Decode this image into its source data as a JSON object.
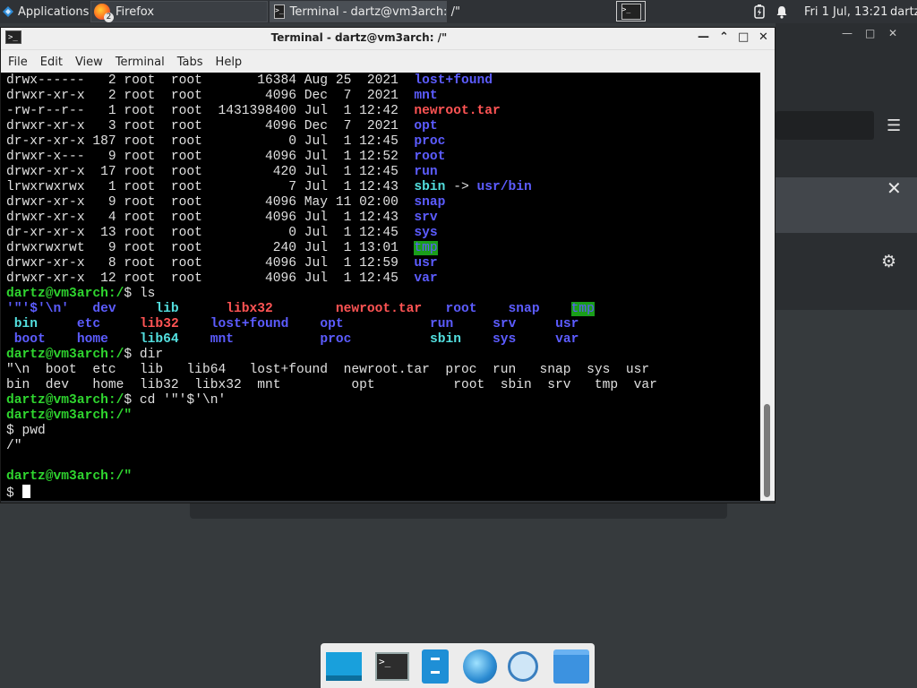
{
  "top_panel": {
    "applications_label": "Applications",
    "tasks": [
      {
        "label": "Firefox",
        "badge": "2"
      },
      {
        "label": "Terminal - dartz@vm3arch: /\""
      }
    ],
    "clock": "Fri  1 Jul, 13:21",
    "user": "dartz"
  },
  "terminal_window": {
    "title": "Terminal - dartz@vm3arch: /\"",
    "menu": [
      "File",
      "Edit",
      "View",
      "Terminal",
      "Tabs",
      "Help"
    ],
    "lines": [
      [
        {
          "t": "drwx------   2 root  root       16384 Aug 25  2021  "
        },
        {
          "t": "lost+found",
          "c": "c-dir"
        }
      ],
      [
        {
          "t": "drwxr-xr-x   2 root  root        4096 Dec  7  2021  "
        },
        {
          "t": "mnt",
          "c": "c-dir"
        }
      ],
      [
        {
          "t": "-rw-r--r--   1 root  root  1431398400 Jul  1 12:42  "
        },
        {
          "t": "newroot.tar",
          "c": "c-red"
        }
      ],
      [
        {
          "t": "drwxr-xr-x   3 root  root        4096 Dec  7  2021  "
        },
        {
          "t": "opt",
          "c": "c-dir"
        }
      ],
      [
        {
          "t": "dr-xr-xr-x 187 root  root           0 Jul  1 12:45  "
        },
        {
          "t": "proc",
          "c": "c-dir"
        }
      ],
      [
        {
          "t": "drwxr-x---   9 root  root        4096 Jul  1 12:52  "
        },
        {
          "t": "root",
          "c": "c-dir"
        }
      ],
      [
        {
          "t": "drwxr-xr-x  17 root  root         420 Jul  1 12:45  "
        },
        {
          "t": "run",
          "c": "c-dir"
        }
      ],
      [
        {
          "t": "lrwxrwxrwx   1 root  root           7 Jul  1 12:43  "
        },
        {
          "t": "sbin",
          "c": "c-cyan"
        },
        {
          "t": " -> "
        },
        {
          "t": "usr/bin",
          "c": "c-dir"
        }
      ],
      [
        {
          "t": "drwxr-xr-x   9 root  root        4096 May 11 02:00  "
        },
        {
          "t": "snap",
          "c": "c-dir"
        }
      ],
      [
        {
          "t": "drwxr-xr-x   4 root  root        4096 Jul  1 12:43  "
        },
        {
          "t": "srv",
          "c": "c-dir"
        }
      ],
      [
        {
          "t": "dr-xr-xr-x  13 root  root           0 Jul  1 12:45  "
        },
        {
          "t": "sys",
          "c": "c-dir"
        }
      ],
      [
        {
          "t": "drwxrwxrwt   9 root  root         240 Jul  1 13:01  "
        },
        {
          "t": "tmp",
          "c": "c-tmp"
        }
      ],
      [
        {
          "t": "drwxr-xr-x   8 root  root        4096 Jul  1 12:59  "
        },
        {
          "t": "usr",
          "c": "c-dir"
        }
      ],
      [
        {
          "t": "drwxr-xr-x  12 root  root        4096 Jul  1 12:45  "
        },
        {
          "t": "var",
          "c": "c-dir"
        }
      ],
      [
        {
          "t": "dartz@vm3arch:/",
          "c": "c-prompt"
        },
        {
          "t": "$ ls"
        }
      ],
      [
        {
          "t": "'\"'$'\\n'",
          "c": "c-dir"
        },
        {
          "t": "   "
        },
        {
          "t": "dev",
          "c": "c-dir"
        },
        {
          "t": "     "
        },
        {
          "t": "lib",
          "c": "c-cyan"
        },
        {
          "t": "      "
        },
        {
          "t": "libx32",
          "c": "c-red"
        },
        {
          "t": "        "
        },
        {
          "t": "newroot.tar",
          "c": "c-red"
        },
        {
          "t": "   "
        },
        {
          "t": "root",
          "c": "c-dir"
        },
        {
          "t": "    "
        },
        {
          "t": "snap",
          "c": "c-dir"
        },
        {
          "t": "    "
        },
        {
          "t": "tmp",
          "c": "c-tmp"
        }
      ],
      [
        {
          "t": " "
        },
        {
          "t": "bin",
          "c": "c-cyan"
        },
        {
          "t": "     "
        },
        {
          "t": "etc",
          "c": "c-dir"
        },
        {
          "t": "     "
        },
        {
          "t": "lib32",
          "c": "c-red"
        },
        {
          "t": "    "
        },
        {
          "t": "lost+found",
          "c": "c-dir"
        },
        {
          "t": "    "
        },
        {
          "t": "opt",
          "c": "c-dir"
        },
        {
          "t": "           "
        },
        {
          "t": "run",
          "c": "c-dir"
        },
        {
          "t": "     "
        },
        {
          "t": "srv",
          "c": "c-dir"
        },
        {
          "t": "     "
        },
        {
          "t": "usr",
          "c": "c-dir"
        }
      ],
      [
        {
          "t": " "
        },
        {
          "t": "boot",
          "c": "c-dir"
        },
        {
          "t": "    "
        },
        {
          "t": "home",
          "c": "c-dir"
        },
        {
          "t": "    "
        },
        {
          "t": "lib64",
          "c": "c-cyan"
        },
        {
          "t": "    "
        },
        {
          "t": "mnt",
          "c": "c-dir"
        },
        {
          "t": "           "
        },
        {
          "t": "proc",
          "c": "c-dir"
        },
        {
          "t": "          "
        },
        {
          "t": "sbin",
          "c": "c-cyan"
        },
        {
          "t": "    "
        },
        {
          "t": "sys",
          "c": "c-dir"
        },
        {
          "t": "     "
        },
        {
          "t": "var",
          "c": "c-dir"
        }
      ],
      [
        {
          "t": "dartz@vm3arch:/",
          "c": "c-prompt"
        },
        {
          "t": "$ dir"
        }
      ],
      [
        {
          "t": "\"\\n  boot  etc   lib   lib64   lost+found  newroot.tar  proc  run   snap  sys  usr"
        }
      ],
      [
        {
          "t": "bin  dev   home  lib32  libx32  mnt         opt          root  sbin  srv   tmp  var"
        }
      ],
      [
        {
          "t": "dartz@vm3arch:/",
          "c": "c-prompt"
        },
        {
          "t": "$ cd '\"'$'\\n'"
        }
      ],
      [
        {
          "t": "dartz@vm3arch:/\"",
          "c": "c-prompt"
        }
      ],
      [
        {
          "t": "$ pwd"
        }
      ],
      [
        {
          "t": "/\""
        }
      ],
      [
        {
          "t": ""
        }
      ],
      [
        {
          "t": "dartz@vm3arch:/\"",
          "c": "c-prompt"
        }
      ],
      [
        {
          "t": "$ "
        },
        {
          "cursor": true
        }
      ]
    ]
  },
  "dock": {
    "items": [
      "show-desktop",
      "terminal",
      "files",
      "web-browser",
      "search",
      "file-manager"
    ]
  }
}
